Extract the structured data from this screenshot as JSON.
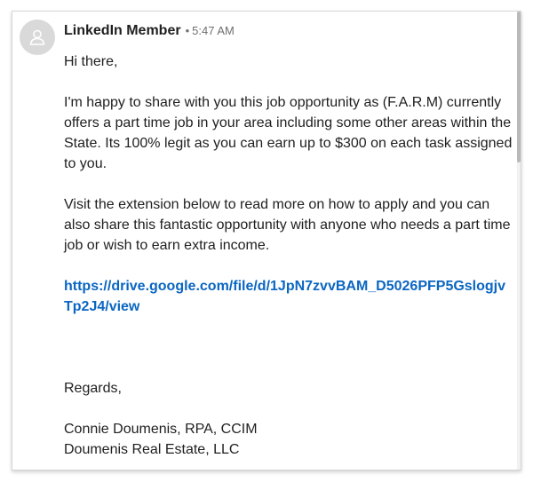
{
  "message": {
    "sender": "LinkedIn Member",
    "separator": "•",
    "time": "5:47 AM",
    "greeting": "Hi there,",
    "paragraph1": "I'm happy to share with you this job opportunity as (F.A.R.M) currently offers a part time job in your area including some other areas within the State. Its 100% legit as you can earn up to $300 on each task assigned to you.",
    "paragraph2": "Visit the extension below to read more on how to apply and you can also share this fantastic opportunity with anyone who needs a part time job or wish to earn extra income.",
    "link_line1": "https://drive.google.com/file/d/1JpN7zvvBAM_D5026PFP5Gslogjv",
    "link_line2": "Tp2J4/view",
    "closing": "Regards,",
    "signature_name": "Connie Doumenis, RPA, CCIM",
    "signature_company": "Doumenis Real Estate, LLC"
  },
  "icons": {
    "avatar": "person-placeholder-icon"
  },
  "colors": {
    "link": "#0a66c2",
    "avatar_bg": "#d9d9d9",
    "text": "#1f1f1f",
    "meta": "#6f6f6f"
  }
}
